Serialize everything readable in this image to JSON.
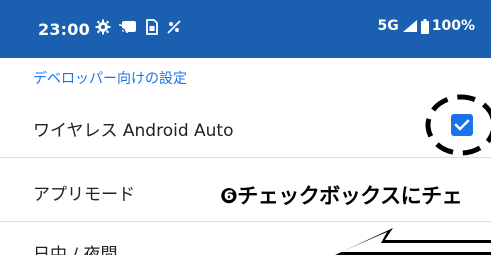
{
  "status_bar": {
    "time": "23:00",
    "network": "5G",
    "battery": "100%",
    "icons_left": [
      "gear-icon",
      "cast-icon",
      "sim-icon",
      "airplane-icon"
    ],
    "icons_right": [
      "signal-icon",
      "battery-icon"
    ],
    "background_color": "#1a5fb0"
  },
  "settings": {
    "section_header": "デベロッパー向けの設定",
    "items": [
      {
        "label": "ワイヤレス Android Auto",
        "checked": true
      },
      {
        "label": "アプリモード"
      },
      {
        "label": "日中 / 夜間"
      }
    ]
  },
  "annotation": {
    "text": "❻チェックボックスにチェ"
  },
  "colors": {
    "accent": "#1a73e8",
    "divider": "#dadce0"
  }
}
